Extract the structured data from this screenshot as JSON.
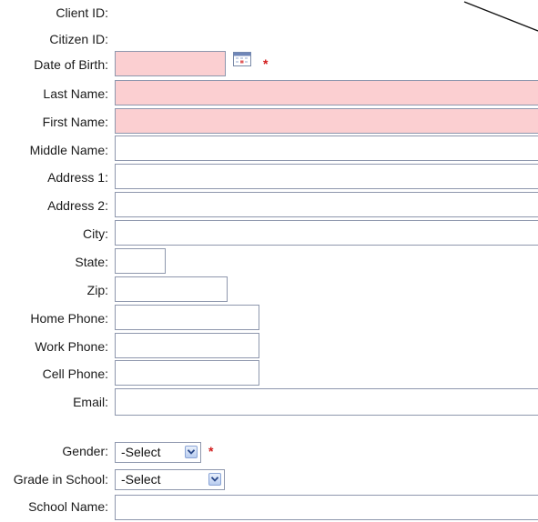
{
  "form": {
    "client_id_label": "Client ID:",
    "citizen_id_label": "Citizen ID:",
    "dob_label": "Date of Birth:",
    "last_name_label": "Last Name:",
    "first_name_label": "First Name:",
    "middle_name_label": "Middle Name:",
    "address1_label": "Address 1:",
    "address2_label": "Address 2:",
    "city_label": "City:",
    "state_label": "State:",
    "zip_label": "Zip:",
    "home_phone_label": "Home Phone:",
    "work_phone_label": "Work Phone:",
    "cell_phone_label": "Cell Phone:",
    "email_label": "Email:",
    "gender_label": "Gender:",
    "grade_label": "Grade in School:",
    "school_name_label": "School Name:",
    "required_marker": "*",
    "gender_selected": "-Select",
    "grade_selected": "-Select"
  },
  "icons": {
    "calendar": "calendar-icon",
    "dropdown": "chevron-down-icon"
  },
  "colors": {
    "required_bg": "#fbcfd1",
    "required_star": "#d21a1a",
    "field_border": "#8e97ad"
  }
}
